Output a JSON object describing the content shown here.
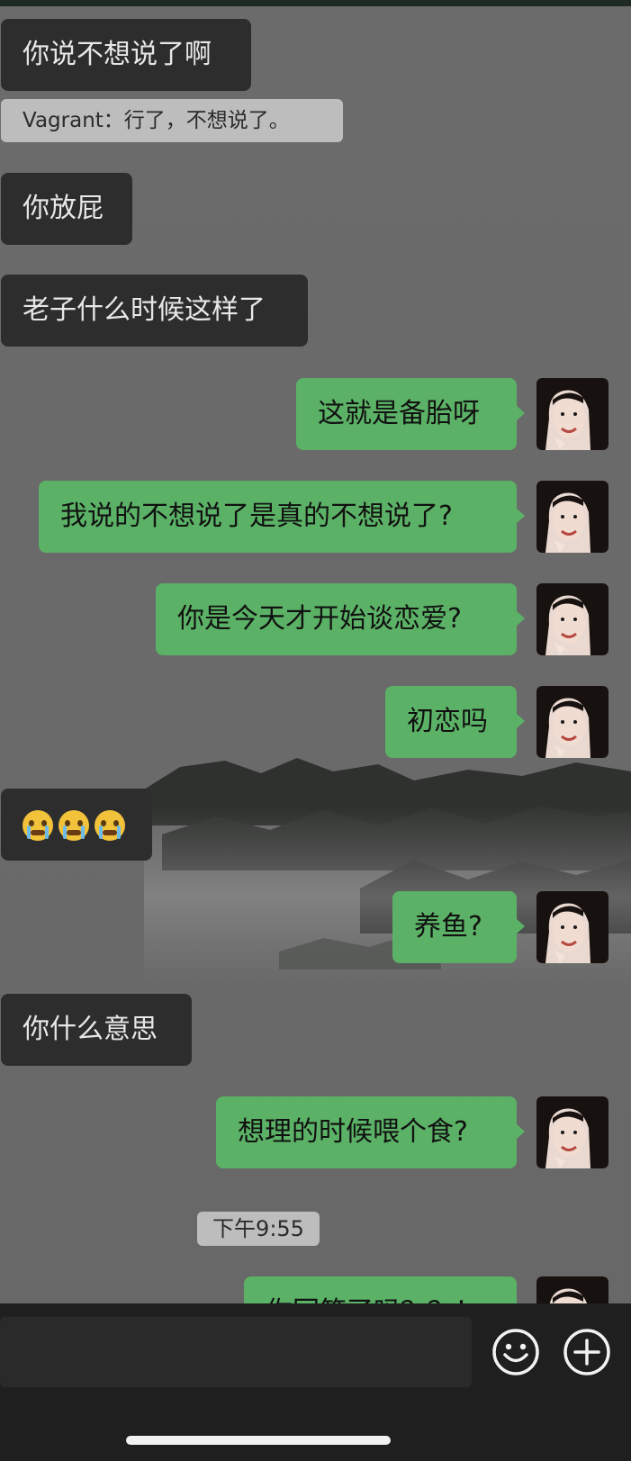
{
  "messages": [
    {
      "side": "left",
      "text": "你说不想说了啊"
    },
    {
      "side": "system",
      "text": "Vagrant：行了，不想说了。"
    },
    {
      "side": "left",
      "text": "你放屁"
    },
    {
      "side": "left",
      "text": "老子什么时候这样了"
    },
    {
      "side": "right",
      "text": "这就是备胎呀"
    },
    {
      "side": "right",
      "text": "我说的不想说了是真的不想说了?"
    },
    {
      "side": "right",
      "text": "你是今天才开始谈恋爱?"
    },
    {
      "side": "right",
      "text": "初恋吗"
    },
    {
      "side": "left",
      "emoji_count": 3,
      "emoji": "crying-face-emoji"
    },
    {
      "side": "right",
      "text": "养鱼?"
    },
    {
      "side": "left",
      "text": "你什么意思"
    },
    {
      "side": "right",
      "text": "想理的时候喂个食?"
    },
    {
      "side": "time",
      "text": "下午9:55"
    },
    {
      "side": "right",
      "text": "你回答了吗？？！"
    }
  ],
  "input_bar": {
    "emoji_icon": "smiley-icon",
    "add_icon": "plus-circle-icon"
  },
  "colors": {
    "self_bubble": "#5bb266",
    "other_bubble": "#2d2d2d",
    "background": "#6e6e6e",
    "bar": "#1f1f1f"
  }
}
